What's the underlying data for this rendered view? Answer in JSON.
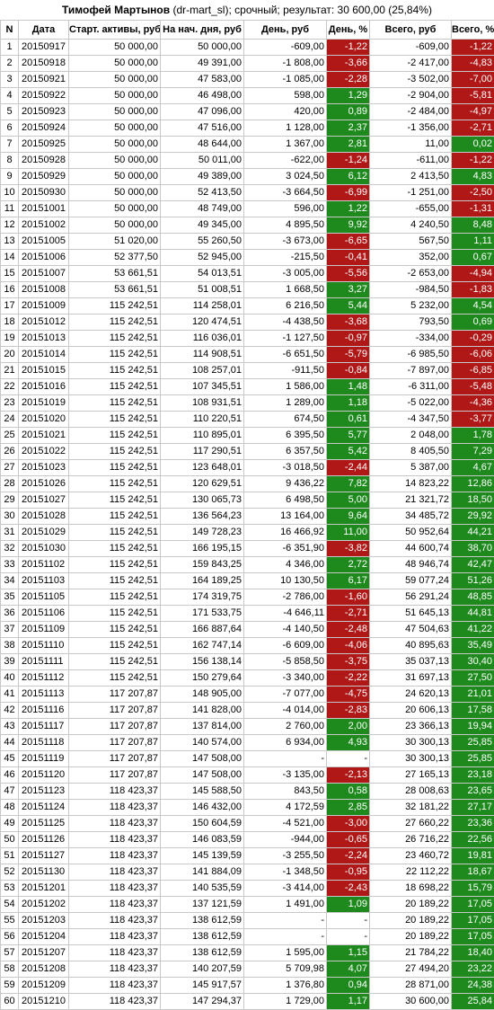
{
  "title": {
    "name": "Тимофей Мартынов",
    "rest": " (dr-mart_sl); срочный; результат: 30 600,00 (25,84%)"
  },
  "colors": {
    "positive": "#1e8a1e",
    "negative": "#b01818"
  },
  "headers": [
    "N",
    "Дата",
    "Старт. активы, руб",
    "На нач. дня, руб",
    "День, руб",
    "День, %",
    "Всего, руб",
    "Всего, %"
  ],
  "rows": [
    [
      "1",
      "20150917",
      "50 000,00",
      "50 000,00",
      "-609,00",
      "-1,22",
      "-609,00",
      "-1,22"
    ],
    [
      "2",
      "20150918",
      "50 000,00",
      "49 391,00",
      "-1 808,00",
      "-3,66",
      "-2 417,00",
      "-4,83"
    ],
    [
      "3",
      "20150921",
      "50 000,00",
      "47 583,00",
      "-1 085,00",
      "-2,28",
      "-3 502,00",
      "-7,00"
    ],
    [
      "4",
      "20150922",
      "50 000,00",
      "46 498,00",
      "598,00",
      "1,29",
      "-2 904,00",
      "-5,81"
    ],
    [
      "5",
      "20150923",
      "50 000,00",
      "47 096,00",
      "420,00",
      "0,89",
      "-2 484,00",
      "-4,97"
    ],
    [
      "6",
      "20150924",
      "50 000,00",
      "47 516,00",
      "1 128,00",
      "2,37",
      "-1 356,00",
      "-2,71"
    ],
    [
      "7",
      "20150925",
      "50 000,00",
      "48 644,00",
      "1 367,00",
      "2,81",
      "11,00",
      "0,02"
    ],
    [
      "8",
      "20150928",
      "50 000,00",
      "50 011,00",
      "-622,00",
      "-1,24",
      "-611,00",
      "-1,22"
    ],
    [
      "9",
      "20150929",
      "50 000,00",
      "49 389,00",
      "3 024,50",
      "6,12",
      "2 413,50",
      "4,83"
    ],
    [
      "10",
      "20150930",
      "50 000,00",
      "52 413,50",
      "-3 664,50",
      "-6,99",
      "-1 251,00",
      "-2,50"
    ],
    [
      "11",
      "20151001",
      "50 000,00",
      "48 749,00",
      "596,00",
      "1,22",
      "-655,00",
      "-1,31"
    ],
    [
      "12",
      "20151002",
      "50 000,00",
      "49 345,00",
      "4 895,50",
      "9,92",
      "4 240,50",
      "8,48"
    ],
    [
      "13",
      "20151005",
      "51 020,00",
      "55 260,50",
      "-3 673,00",
      "-6,65",
      "567,50",
      "1,11"
    ],
    [
      "14",
      "20151006",
      "52 377,50",
      "52 945,00",
      "-215,50",
      "-0,41",
      "352,00",
      "0,67"
    ],
    [
      "15",
      "20151007",
      "53 661,51",
      "54 013,51",
      "-3 005,00",
      "-5,56",
      "-2 653,00",
      "-4,94"
    ],
    [
      "16",
      "20151008",
      "53 661,51",
      "51 008,51",
      "1 668,50",
      "3,27",
      "-984,50",
      "-1,83"
    ],
    [
      "17",
      "20151009",
      "115 242,51",
      "114 258,01",
      "6 216,50",
      "5,44",
      "5 232,00",
      "4,54"
    ],
    [
      "18",
      "20151012",
      "115 242,51",
      "120 474,51",
      "-4 438,50",
      "-3,68",
      "793,50",
      "0,69"
    ],
    [
      "19",
      "20151013",
      "115 242,51",
      "116 036,01",
      "-1 127,50",
      "-0,97",
      "-334,00",
      "-0,29"
    ],
    [
      "20",
      "20151014",
      "115 242,51",
      "114 908,51",
      "-6 651,50",
      "-5,79",
      "-6 985,50",
      "-6,06"
    ],
    [
      "21",
      "20151015",
      "115 242,51",
      "108 257,01",
      "-911,50",
      "-0,84",
      "-7 897,00",
      "-6,85"
    ],
    [
      "22",
      "20151016",
      "115 242,51",
      "107 345,51",
      "1 586,00",
      "1,48",
      "-6 311,00",
      "-5,48"
    ],
    [
      "23",
      "20151019",
      "115 242,51",
      "108 931,51",
      "1 289,00",
      "1,18",
      "-5 022,00",
      "-4,36"
    ],
    [
      "24",
      "20151020",
      "115 242,51",
      "110 220,51",
      "674,50",
      "0,61",
      "-4 347,50",
      "-3,77"
    ],
    [
      "25",
      "20151021",
      "115 242,51",
      "110 895,01",
      "6 395,50",
      "5,77",
      "2 048,00",
      "1,78"
    ],
    [
      "26",
      "20151022",
      "115 242,51",
      "117 290,51",
      "6 357,50",
      "5,42",
      "8 405,50",
      "7,29"
    ],
    [
      "27",
      "20151023",
      "115 242,51",
      "123 648,01",
      "-3 018,50",
      "-2,44",
      "5 387,00",
      "4,67"
    ],
    [
      "28",
      "20151026",
      "115 242,51",
      "120 629,51",
      "9 436,22",
      "7,82",
      "14 823,22",
      "12,86"
    ],
    [
      "29",
      "20151027",
      "115 242,51",
      "130 065,73",
      "6 498,50",
      "5,00",
      "21 321,72",
      "18,50"
    ],
    [
      "30",
      "20151028",
      "115 242,51",
      "136 564,23",
      "13 164,00",
      "9,64",
      "34 485,72",
      "29,92"
    ],
    [
      "31",
      "20151029",
      "115 242,51",
      "149 728,23",
      "16 466,92",
      "11,00",
      "50 952,64",
      "44,21"
    ],
    [
      "32",
      "20151030",
      "115 242,51",
      "166 195,15",
      "-6 351,90",
      "-3,82",
      "44 600,74",
      "38,70"
    ],
    [
      "33",
      "20151102",
      "115 242,51",
      "159 843,25",
      "4 346,00",
      "2,72",
      "48 946,74",
      "42,47"
    ],
    [
      "34",
      "20151103",
      "115 242,51",
      "164 189,25",
      "10 130,50",
      "6,17",
      "59 077,24",
      "51,26"
    ],
    [
      "35",
      "20151105",
      "115 242,51",
      "174 319,75",
      "-2 786,00",
      "-1,60",
      "56 291,24",
      "48,85"
    ],
    [
      "36",
      "20151106",
      "115 242,51",
      "171 533,75",
      "-4 646,11",
      "-2,71",
      "51 645,13",
      "44,81"
    ],
    [
      "37",
      "20151109",
      "115 242,51",
      "166 887,64",
      "-4 140,50",
      "-2,48",
      "47 504,63",
      "41,22"
    ],
    [
      "38",
      "20151110",
      "115 242,51",
      "162 747,14",
      "-6 609,00",
      "-4,06",
      "40 895,63",
      "35,49"
    ],
    [
      "39",
      "20151111",
      "115 242,51",
      "156 138,14",
      "-5 858,50",
      "-3,75",
      "35 037,13",
      "30,40"
    ],
    [
      "40",
      "20151112",
      "115 242,51",
      "150 279,64",
      "-3 340,00",
      "-2,22",
      "31 697,13",
      "27,50"
    ],
    [
      "41",
      "20151113",
      "117 207,87",
      "148 905,00",
      "-7 077,00",
      "-4,75",
      "24 620,13",
      "21,01"
    ],
    [
      "42",
      "20151116",
      "117 207,87",
      "141 828,00",
      "-4 014,00",
      "-2,83",
      "20 606,13",
      "17,58"
    ],
    [
      "43",
      "20151117",
      "117 207,87",
      "137 814,00",
      "2 760,00",
      "2,00",
      "23 366,13",
      "19,94"
    ],
    [
      "44",
      "20151118",
      "117 207,87",
      "140 574,00",
      "6 934,00",
      "4,93",
      "30 300,13",
      "25,85"
    ],
    [
      "45",
      "20151119",
      "117 207,87",
      "147 508,00",
      "-",
      "-",
      "30 300,13",
      "25,85"
    ],
    [
      "46",
      "20151120",
      "117 207,87",
      "147 508,00",
      "-3 135,00",
      "-2,13",
      "27 165,13",
      "23,18"
    ],
    [
      "47",
      "20151123",
      "118 423,37",
      "145 588,50",
      "843,50",
      "0,58",
      "28 008,63",
      "23,65"
    ],
    [
      "48",
      "20151124",
      "118 423,37",
      "146 432,00",
      "4 172,59",
      "2,85",
      "32 181,22",
      "27,17"
    ],
    [
      "49",
      "20151125",
      "118 423,37",
      "150 604,59",
      "-4 521,00",
      "-3,00",
      "27 660,22",
      "23,36"
    ],
    [
      "50",
      "20151126",
      "118 423,37",
      "146 083,59",
      "-944,00",
      "-0,65",
      "26 716,22",
      "22,56"
    ],
    [
      "51",
      "20151127",
      "118 423,37",
      "145 139,59",
      "-3 255,50",
      "-2,24",
      "23 460,72",
      "19,81"
    ],
    [
      "52",
      "20151130",
      "118 423,37",
      "141 884,09",
      "-1 348,50",
      "-0,95",
      "22 112,22",
      "18,67"
    ],
    [
      "53",
      "20151201",
      "118 423,37",
      "140 535,59",
      "-3 414,00",
      "-2,43",
      "18 698,22",
      "15,79"
    ],
    [
      "54",
      "20151202",
      "118 423,37",
      "137 121,59",
      "1 491,00",
      "1,09",
      "20 189,22",
      "17,05"
    ],
    [
      "55",
      "20151203",
      "118 423,37",
      "138 612,59",
      "-",
      "-",
      "20 189,22",
      "17,05"
    ],
    [
      "56",
      "20151204",
      "118 423,37",
      "138 612,59",
      "-",
      "-",
      "20 189,22",
      "17,05"
    ],
    [
      "57",
      "20151207",
      "118 423,37",
      "138 612,59",
      "1 595,00",
      "1,15",
      "21 784,22",
      "18,40"
    ],
    [
      "58",
      "20151208",
      "118 423,37",
      "140 207,59",
      "5 709,98",
      "4,07",
      "27 494,20",
      "23,22"
    ],
    [
      "59",
      "20151209",
      "118 423,37",
      "145 917,57",
      "1 376,80",
      "0,94",
      "28 871,00",
      "24,38"
    ],
    [
      "60",
      "20151210",
      "118 423,37",
      "147 294,37",
      "1 729,00",
      "1,17",
      "30 600,00",
      "25,84"
    ]
  ]
}
